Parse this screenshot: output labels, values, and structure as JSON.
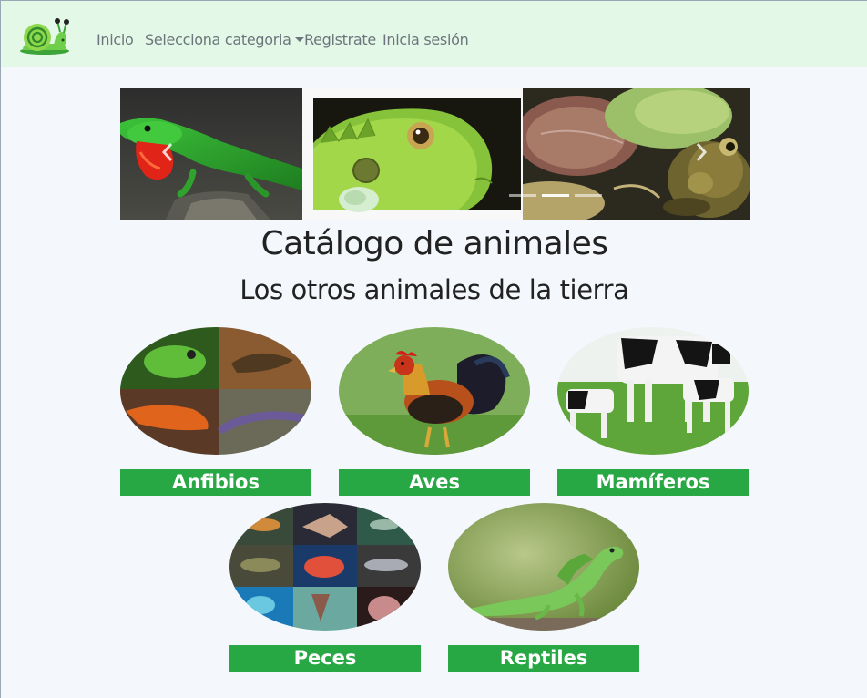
{
  "nav": {
    "logo_icon": "snail-icon",
    "items": [
      {
        "label": "Inicio"
      },
      {
        "label": "Selecciona categoria",
        "dropdown": true
      },
      {
        "label": "Registrate"
      },
      {
        "label": "Inicia sesión"
      }
    ]
  },
  "carousel": {
    "slides": [
      "anole-lizard",
      "iguana",
      "frog"
    ],
    "indicators": 3,
    "active_index": 1
  },
  "headings": {
    "title": "Catálogo de animales",
    "subtitle": "Los otros animales de la tierra"
  },
  "categories": [
    {
      "label": "Anfibios"
    },
    {
      "label": "Aves"
    },
    {
      "label": "Mamíferos"
    },
    {
      "label": "Peces"
    },
    {
      "label": "Reptiles"
    }
  ],
  "colors": {
    "navbar_bg": "#e3f8e6",
    "category_button": "#28a745",
    "page_bg": "#f4f7fb"
  }
}
